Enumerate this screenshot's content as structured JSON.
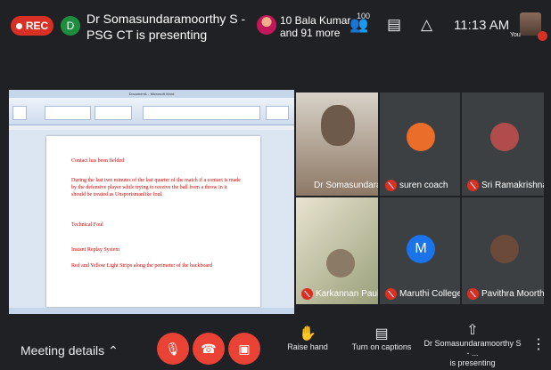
{
  "topbar": {
    "rec_label": "REC",
    "presenter_initial": "D",
    "presenter_text": "Dr Somasundaramoorthy S - PSG CT is presenting",
    "others_line1": "10 Bala Kumar",
    "others_line2": "and 91 more",
    "people_count": "100",
    "time": "11:13 AM",
    "you_label": "You"
  },
  "doc": {
    "window_title": "Document1 - Microsoft Word",
    "lines": [
      "Contact has been fielded",
      "During the last two minutes of the last quarter of the match if a contact is made by the defensive player while trying to receive the ball from a throw in it should be treated as Unsportsmanlike foul.",
      "Technical Foul",
      "Instant Replay System",
      "Red and Yellow Light Strips along the perimeter of the backboard"
    ]
  },
  "participants": [
    {
      "name": "Dr Somasundara...",
      "color": "#6d5a4a"
    },
    {
      "name": "suren coach",
      "color": "#ea6d2a"
    },
    {
      "name": "Sri Ramakrishna ...",
      "color": "#b04c4c"
    },
    {
      "name": "Karkannan Paulraj",
      "color": "#8a7a66"
    },
    {
      "name": "Maruthi College",
      "initial": "M",
      "color": "#1a73e8"
    },
    {
      "name": "Pavithra Moorthy",
      "color": "#6b4a3a"
    }
  ],
  "bottom": {
    "meeting_details": "Meeting details",
    "raise_hand": "Raise hand",
    "captions": "Turn on captions",
    "presenting_line1": "Dr Somasundaramoorthy S - ...",
    "presenting_line2": "is presenting"
  },
  "colors": {
    "end_call": "#ea4335",
    "rec": "#d93025",
    "bg": "#202124"
  }
}
